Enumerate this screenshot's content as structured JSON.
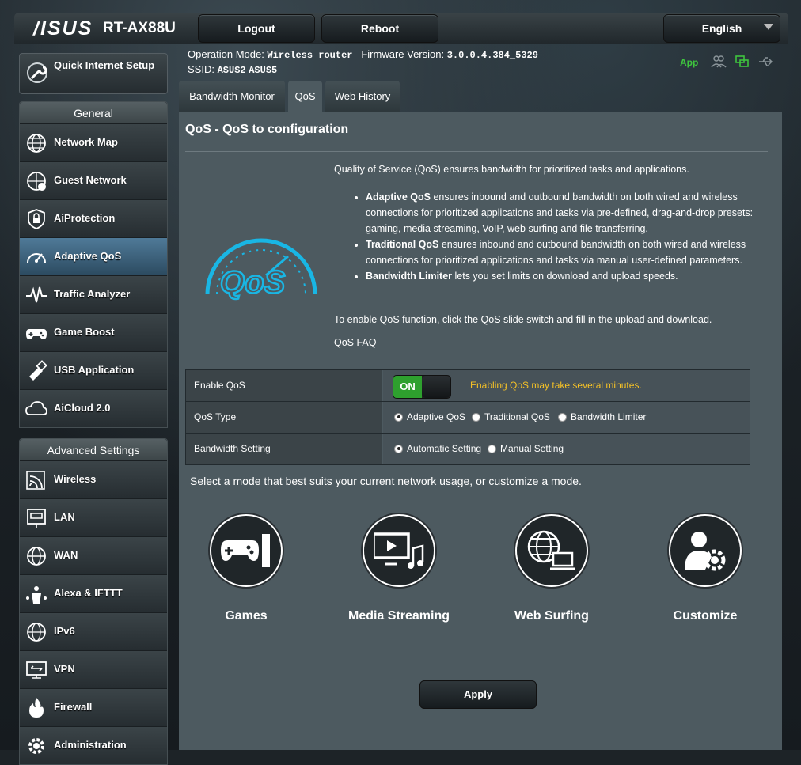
{
  "header": {
    "logo": "/ISUS",
    "model": "RT-AX88U",
    "logout_label": "Logout",
    "reboot_label": "Reboot",
    "language": "English"
  },
  "info_bar": {
    "operation_mode_label": "Operation Mode:",
    "operation_mode_value": "Wireless router",
    "firmware_label": "Firmware Version:",
    "firmware_value": "3.0.0.4.384_5329",
    "ssid_label": "SSID:",
    "ssid_1": "ASUS2",
    "ssid_2": "ASUS5",
    "app_label": "App"
  },
  "sidebar": {
    "quick_setup": "Quick Internet Setup",
    "general_title": "General",
    "general_items": [
      {
        "label": "Network Map",
        "icon": "globe-icon"
      },
      {
        "label": "Guest Network",
        "icon": "guest-globe-icon"
      },
      {
        "label": "AiProtection",
        "icon": "lock-icon"
      },
      {
        "label": "Adaptive QoS",
        "icon": "speedometer-icon",
        "active": true
      },
      {
        "label": "Traffic Analyzer",
        "icon": "pulse-icon"
      },
      {
        "label": "Game Boost",
        "icon": "gamepad-icon"
      },
      {
        "label": "USB Application",
        "icon": "usb-icon"
      },
      {
        "label": "AiCloud 2.0",
        "icon": "cloud-icon"
      }
    ],
    "advanced_title": "Advanced Settings",
    "advanced_items": [
      {
        "label": "Wireless",
        "icon": "wifi-icon"
      },
      {
        "label": "LAN",
        "icon": "lan-icon"
      },
      {
        "label": "WAN",
        "icon": "wan-globe-icon"
      },
      {
        "label": "Alexa & IFTTT",
        "icon": "alexa-icon"
      },
      {
        "label": "IPv6",
        "icon": "ipv6-icon"
      },
      {
        "label": "VPN",
        "icon": "vpn-icon"
      },
      {
        "label": "Firewall",
        "icon": "firewall-icon"
      },
      {
        "label": "Administration",
        "icon": "admin-gear-icon"
      }
    ]
  },
  "tabs": [
    {
      "label": "Bandwidth Monitor"
    },
    {
      "label": "QoS",
      "active": true
    },
    {
      "label": "Web History"
    }
  ],
  "main": {
    "title": "QoS - QoS to configuration",
    "intro": "Quality of Service (QoS) ensures bandwidth for prioritized tasks and applications.",
    "bullet1_bold": "Adaptive QoS",
    "bullet1_text": " ensures inbound and outbound bandwidth on both wired and wireless connections for prioritized applications and tasks via pre-defined, drag-and-drop presets: gaming, media streaming, VoIP, web surfing and file transferring.",
    "bullet2_bold": "Traditional QoS",
    "bullet2_text": " ensures inbound and outbound bandwidth on both wired and wireless connections for prioritized applications and tasks via manual user-defined parameters.",
    "bullet3_bold": "Bandwidth Limiter",
    "bullet3_text": " lets you set limits on download and upload speeds.",
    "enable_hint": "To enable QoS function, click the QoS slide switch and fill in the upload and download.",
    "faq_link": "QoS FAQ",
    "logo_text": "QoS"
  },
  "form": {
    "enable_label": "Enable QoS",
    "toggle_on": "ON",
    "warning": "Enabling QoS may take several minutes.",
    "type_label": "QoS Type",
    "type_options": [
      "Adaptive QoS",
      "Traditional QoS",
      "Bandwidth Limiter"
    ],
    "type_selected": "Adaptive QoS",
    "bandwidth_label": "Bandwidth Setting",
    "bandwidth_options": [
      "Automatic Setting",
      "Manual Setting"
    ],
    "bandwidth_selected": "Automatic Setting"
  },
  "modes": {
    "prompt": "Select a mode that best suits your current network usage, or customize a mode.",
    "items": [
      {
        "label": "Games",
        "icon": "gamepad-icon"
      },
      {
        "label": "Media Streaming",
        "icon": "media-icon"
      },
      {
        "label": "Web Surfing",
        "icon": "web-icon"
      },
      {
        "label": "Customize",
        "icon": "customize-icon"
      }
    ]
  },
  "apply_label": "Apply",
  "colors": {
    "accent_green": "#3ec43e",
    "warning_yellow": "#f5c126",
    "qos_cyan": "#19b6e4",
    "active_item": "#4f7a98"
  }
}
